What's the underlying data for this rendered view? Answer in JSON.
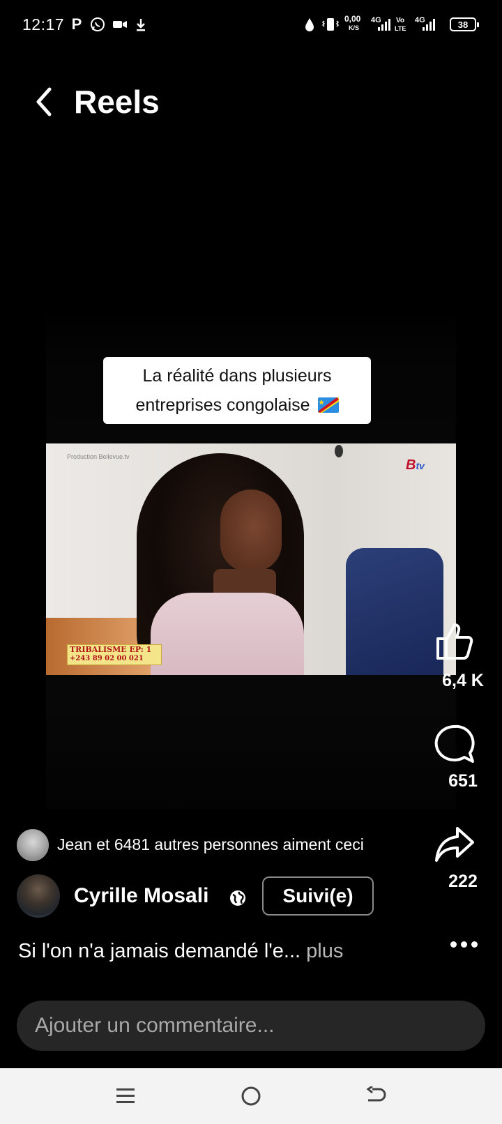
{
  "status_bar": {
    "time": "12:17",
    "net_speed_value": "0,00",
    "net_speed_unit": "K/S",
    "net_4g_a": "4G",
    "volte_top": "Vo",
    "volte_bottom": "LTE",
    "net_4g_b": "4G",
    "battery": "38",
    "icons": [
      "parking-icon",
      "whatsapp-icon",
      "video-camera-icon",
      "download-icon",
      "water-drop-icon",
      "vibrate-icon",
      "signal-icon",
      "signal-icon"
    ]
  },
  "header": {
    "title": "Reels",
    "back_icon": "chevron-left-icon"
  },
  "video": {
    "caption": [
      "La réalité dans plusieurs",
      "entreprises congolaise"
    ],
    "caption_flag": "dr-congo-flag",
    "channel_logo": "B",
    "channel_logo_suffix": "tv",
    "production_watermark": "Production Bellevue.tv",
    "show_tag_title": "TRIBALISME EP: 1",
    "show_tag_phone": "+243 89 02 00 021"
  },
  "actions": {
    "like_count": "6,4 K",
    "comment_count": "651",
    "share_count": "222"
  },
  "likes_summary": "Jean et 6481 autres personnes aiment ceci",
  "author": {
    "name": "Cyrille Mosali",
    "visibility_icon": "globe-icon",
    "follow_label": "Suivi(e)"
  },
  "description": {
    "text": "Si l'on n'a jamais demandé l'e...",
    "more": "plus"
  },
  "comment": {
    "placeholder": "Ajouter un commentaire..."
  },
  "nav": {
    "icons": [
      "menu-icon",
      "home-circle-icon",
      "back-arrow-icon"
    ]
  },
  "colors": {
    "background": "#000000",
    "comment_field": "#262626",
    "nav_bar": "#f3f3f3",
    "caption_box": "#ffffff",
    "channel_red": "#c0122c",
    "channel_blue": "#2a56c6"
  }
}
